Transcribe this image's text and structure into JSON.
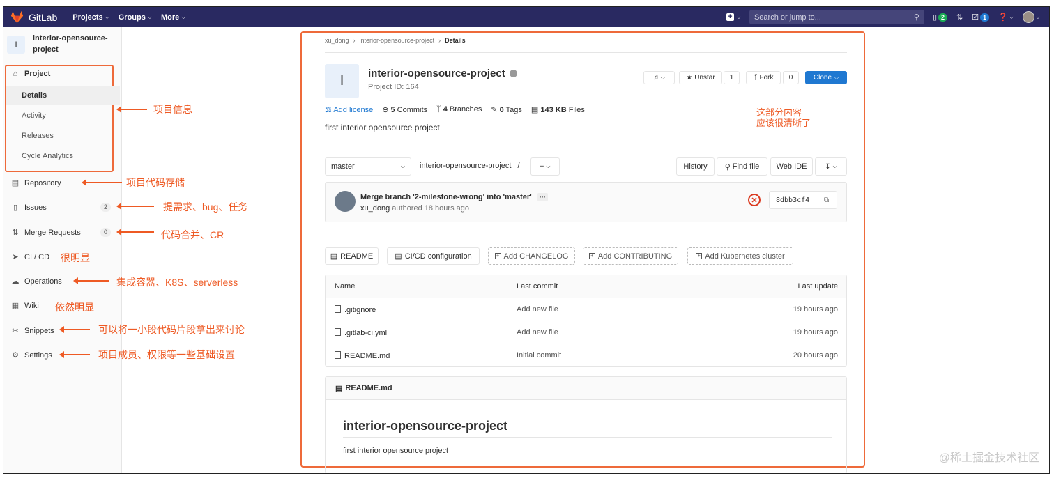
{
  "navbar": {
    "brand": "GitLab",
    "links": [
      "Projects",
      "Groups",
      "More"
    ],
    "search_placeholder": "Search or jump to...",
    "issues_count": "2",
    "todos_count": "1"
  },
  "sidebar": {
    "project_avatar": "I",
    "project_name_line1": "interior-opensource-",
    "project_name_line2": "project",
    "project_label": "Project",
    "sub_items": [
      "Details",
      "Activity",
      "Releases",
      "Cycle Analytics"
    ],
    "repository": "Repository",
    "issues": "Issues",
    "issues_count": "2",
    "merge_requests": "Merge Requests",
    "mr_count": "0",
    "cicd": "CI / CD",
    "operations": "Operations",
    "wiki": "Wiki",
    "snippets": "Snippets",
    "settings": "Settings"
  },
  "annotations": {
    "project_info": "项目信息",
    "repo": "项目代码存储",
    "issues": "提需求、bug、任务",
    "mr": "代码合并、CR",
    "cicd": "很明显",
    "ops": "集成容器、K8S、serverless",
    "wiki": "依然明显",
    "snippets": "可以将一小段代码片段拿出来讨论",
    "settings": "项目成员、权限等一些基础设置",
    "main_line1": "这部分内容",
    "main_line2": "应该很清晰了"
  },
  "breadcrumb": {
    "owner": "xu_dong",
    "project": "interior-opensource-project",
    "current": "Details"
  },
  "project": {
    "avatar": "I",
    "title": "interior-opensource-project",
    "id_label": "Project ID: 164",
    "unstar_label": "Unstar",
    "star_count": "1",
    "fork_label": "Fork",
    "fork_count": "0",
    "clone_label": "Clone",
    "add_license": "Add license",
    "commits_num": "5",
    "commits_label": "Commits",
    "branches_num": "4",
    "branches_label": "Branches",
    "tags_num": "0",
    "tags_label": "Tags",
    "files_size": "143 KB",
    "files_label": "Files",
    "description": "first interior opensource project"
  },
  "repo_bar": {
    "branch": "master",
    "path": "interior-opensource-project",
    "path_sep": "/",
    "history": "History",
    "find_file": "Find file",
    "web_ide": "Web IDE"
  },
  "last_commit": {
    "message": "Merge branch '2-milestone-wrong' into 'master'",
    "author": "xu_dong",
    "authored": "authored 18 hours ago",
    "sha": "8dbb3cf4",
    "status": "failed"
  },
  "quick_buttons": [
    "README",
    "CI/CD configuration",
    "Add CHANGELOG",
    "Add CONTRIBUTING",
    "Add Kubernetes cluster"
  ],
  "files_table": {
    "headers": [
      "Name",
      "Last commit",
      "Last update"
    ],
    "rows": [
      {
        "name": ".gitignore",
        "commit": "Add new file",
        "updated": "19 hours ago"
      },
      {
        "name": ".gitlab-ci.yml",
        "commit": "Add new file",
        "updated": "19 hours ago"
      },
      {
        "name": "README.md",
        "commit": "Initial commit",
        "updated": "20 hours ago"
      }
    ]
  },
  "readme": {
    "file": "README.md",
    "heading": "interior-opensource-project",
    "body": "first interior opensource project"
  },
  "watermark": "@稀土掘金技术社区",
  "colors": {
    "navbar": "#292961",
    "accent": "#1f78d1",
    "annotation": "#ee5a24",
    "fail": "#db3b21"
  }
}
